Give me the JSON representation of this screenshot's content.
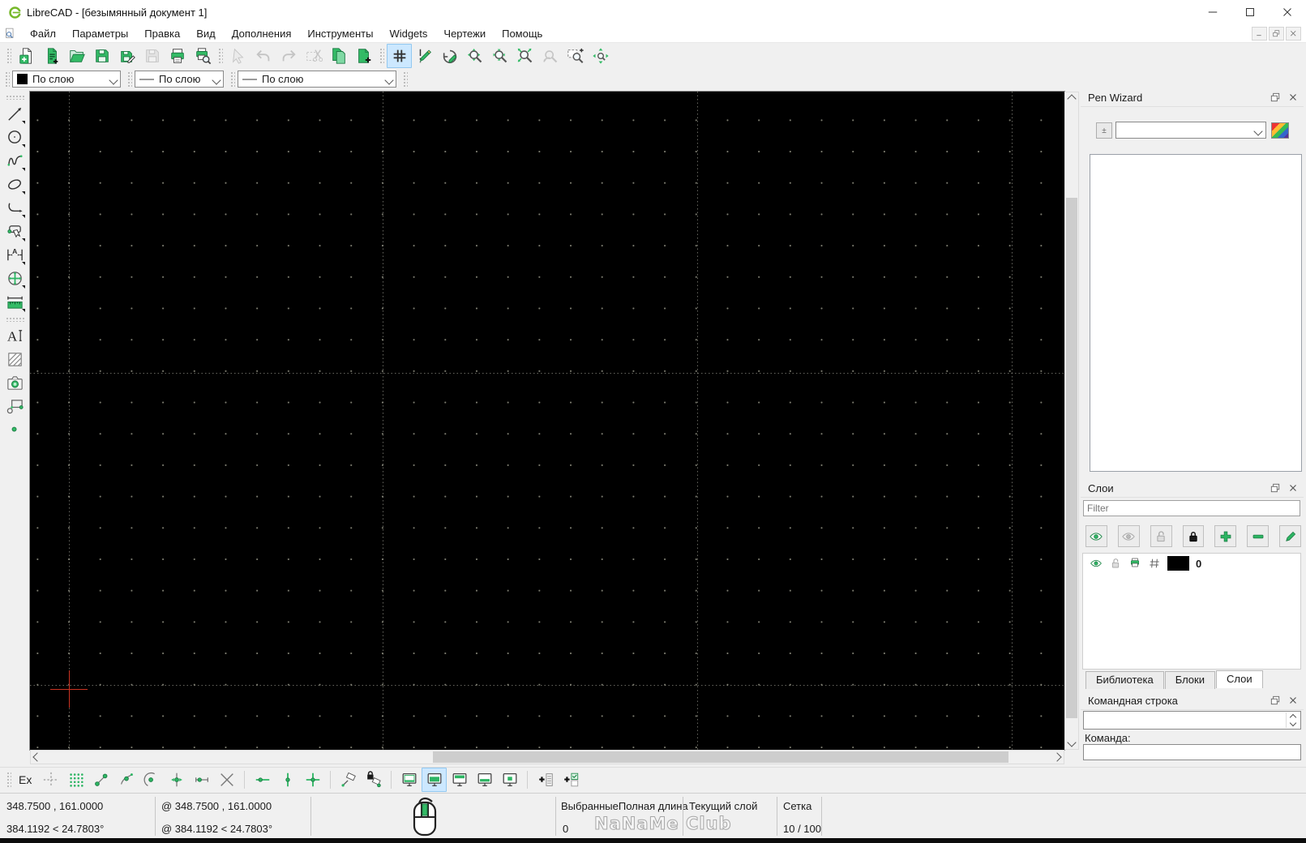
{
  "window": {
    "title": "LibreCAD - [безымянный документ 1]"
  },
  "menubar": {
    "items": [
      "Файл",
      "Параметры",
      "Правка",
      "Вид",
      "Дополнения",
      "Инструменты",
      "Widgets",
      "Чертежи",
      "Помощь"
    ]
  },
  "toolbar_main": [
    {
      "group": "file",
      "items": [
        {
          "icon": "new-drawing"
        },
        {
          "icon": "new-from-template"
        },
        {
          "icon": "open-drawing"
        },
        {
          "icon": "save-drawing"
        },
        {
          "icon": "save-drawing-as"
        },
        {
          "icon": "save-all",
          "disabled": true
        },
        {
          "icon": "print"
        },
        {
          "icon": "print-preview"
        }
      ]
    },
    {
      "group": "edit",
      "items": [
        {
          "icon": "select-pointer",
          "disabled": true
        },
        {
          "icon": "undo",
          "disabled": true
        },
        {
          "icon": "redo",
          "disabled": true
        },
        {
          "icon": "cut",
          "disabled": true
        },
        {
          "icon": "copy"
        },
        {
          "icon": "paste"
        }
      ]
    },
    {
      "group": "view",
      "items": [
        {
          "icon": "grid-toggle",
          "active": true
        },
        {
          "icon": "draft-mode"
        },
        {
          "icon": "redraw"
        },
        {
          "icon": "zoom-in"
        },
        {
          "icon": "zoom-out"
        },
        {
          "icon": "zoom-auto"
        },
        {
          "icon": "zoom-previous",
          "disabled": true
        },
        {
          "icon": "zoom-window"
        },
        {
          "icon": "zoom-pan"
        }
      ]
    }
  ],
  "pen_toolbar": [
    {
      "value": "По слою",
      "swatch": "color"
    },
    {
      "value": "По слою",
      "swatch": "width"
    },
    {
      "value": "По слою",
      "swatch": "linetype"
    }
  ],
  "left_toolbar": [
    {
      "icon": "line-tool",
      "menu": true
    },
    {
      "icon": "circle-tool",
      "menu": true
    },
    {
      "icon": "spline-tool",
      "menu": true
    },
    {
      "icon": "ellipse-tool",
      "menu": true
    },
    {
      "icon": "curve-tool",
      "menu": true
    },
    {
      "icon": "select-tool",
      "menu": true
    },
    {
      "icon": "dimension-tool",
      "menu": true
    },
    {
      "icon": "modify-tool",
      "menu": true
    },
    {
      "icon": "measure-tool",
      "menu": true
    },
    {
      "sep": true
    },
    {
      "icon": "text-tool"
    },
    {
      "icon": "hatch-tool"
    },
    {
      "icon": "image-tool"
    },
    {
      "icon": "block-tool"
    },
    {
      "icon": "point-tool"
    }
  ],
  "pen_wizard": {
    "title": "Pen Wizard",
    "adjust_button": "±",
    "combo_value": ""
  },
  "layers_panel": {
    "title": "Слои",
    "filter_placeholder": "Filter",
    "buttons": [
      {
        "icon": "show-all-layers"
      },
      {
        "icon": "hide-all-layers"
      },
      {
        "icon": "unlock-all-layers"
      },
      {
        "icon": "lock-all-layers"
      },
      {
        "icon": "add-layer"
      },
      {
        "icon": "remove-layer"
      },
      {
        "icon": "edit-layer"
      }
    ],
    "rows": [
      {
        "name": "0",
        "color": "#000000"
      }
    ]
  },
  "dock_tabs": [
    {
      "label": "Библиотека",
      "active": false
    },
    {
      "label": "Блоки",
      "active": false
    },
    {
      "label": "Слои",
      "active": true
    }
  ],
  "command_panel": {
    "title": "Командная строка",
    "prompt_label": "Команда:",
    "input_value": ""
  },
  "snap_toolbar": {
    "exclusive_label": "Ex",
    "items": [
      {
        "icon": "snap-free"
      },
      {
        "icon": "snap-grid"
      },
      {
        "icon": "snap-endpoint"
      },
      {
        "icon": "snap-entity"
      },
      {
        "icon": "snap-center"
      },
      {
        "icon": "snap-middle"
      },
      {
        "icon": "snap-distance"
      },
      {
        "icon": "snap-intersection"
      },
      {
        "sep": true
      },
      {
        "icon": "restrict-horizontal"
      },
      {
        "icon": "restrict-vertical"
      },
      {
        "icon": "restrict-orthogonal"
      },
      {
        "sep": true
      },
      {
        "icon": "set-relative-zero"
      },
      {
        "icon": "lock-relative-zero"
      },
      {
        "sep": true
      },
      {
        "icon": "view-toggle-1"
      },
      {
        "icon": "view-toggle-2",
        "active": true
      },
      {
        "icon": "view-toggle-3"
      },
      {
        "icon": "view-toggle-4"
      },
      {
        "icon": "view-toggle-5"
      },
      {
        "sep": true
      },
      {
        "icon": "add-command-widget"
      },
      {
        "icon": "add-custom-widget"
      }
    ]
  },
  "statusbar": {
    "absolute": {
      "line1": "348.7500 , 161.0000",
      "line2": "384.1192 < 24.7803°"
    },
    "relative": {
      "line1": "@  348.7500 , 161.0000",
      "line2": "@  384.1192 < 24.7803°"
    },
    "selected": {
      "header": "Выбранные",
      "value": "0"
    },
    "total_length": {
      "header": "Полная длина"
    },
    "current_layer": {
      "header": "Текущий слой"
    },
    "grid": {
      "header": "Сетка",
      "value": "10 / 100"
    },
    "watermark": "NaNaMe Club"
  },
  "colors": {
    "accent_green": "#33bb66",
    "canvas_background": "#000000",
    "active_highlight": "#cce8ff",
    "layer_swatch": "#000000",
    "crosshair_red": "#cc3322"
  }
}
